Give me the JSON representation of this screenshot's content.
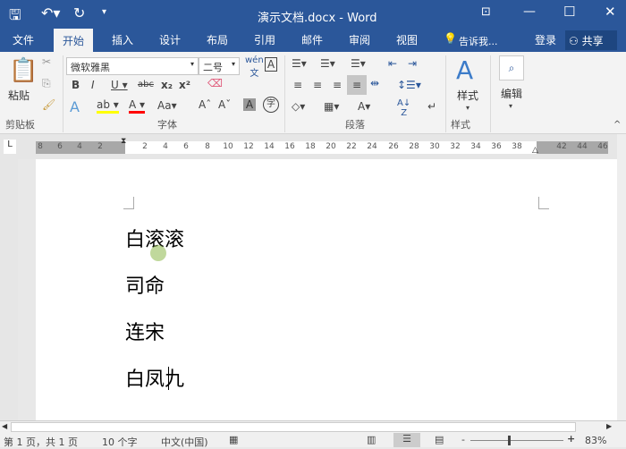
{
  "titlebar": {
    "title": "演示文档.docx - Word",
    "save_icon": "save-icon",
    "undo_icon": "undo-icon",
    "redo_icon": "redo-icon",
    "customize_icon": "customize-icon"
  },
  "tabs": [
    {
      "label": "文件"
    },
    {
      "label": "开始",
      "active": true
    },
    {
      "label": "插入"
    },
    {
      "label": "设计"
    },
    {
      "label": "布局"
    },
    {
      "label": "引用"
    },
    {
      "label": "邮件"
    },
    {
      "label": "审阅"
    },
    {
      "label": "视图"
    }
  ],
  "tell_me": "告诉我...",
  "signin": "登录",
  "share": "共享",
  "ribbon": {
    "clipboard": {
      "label": "剪贴板",
      "paste": "粘贴"
    },
    "font": {
      "label": "字体",
      "font_name": "微软雅黑",
      "font_size": "二号"
    },
    "paragraph": {
      "label": "段落"
    },
    "styles": {
      "label": "样式",
      "button": "样式"
    },
    "editing": {
      "button": "编辑"
    }
  },
  "ruler": {
    "ticks": [
      "8",
      "6",
      "4",
      "2",
      "2",
      "4",
      "6",
      "8",
      "10",
      "12",
      "14",
      "16",
      "18",
      "20",
      "22",
      "24",
      "26",
      "28",
      "30",
      "32",
      "34",
      "36",
      "38",
      "42",
      "44",
      "46"
    ]
  },
  "document": {
    "lines": [
      "白滚滚",
      "司命",
      "连宋",
      "白凤九"
    ]
  },
  "status": {
    "page": "第 1 页，共 1 页",
    "words": "10 个字",
    "language": "中文(中国)",
    "zoom": "83%",
    "zoom_percent": 83
  },
  "colors": {
    "brand": "#2b579a",
    "highlight": "#ffff00",
    "font_color": "#ff0000"
  }
}
